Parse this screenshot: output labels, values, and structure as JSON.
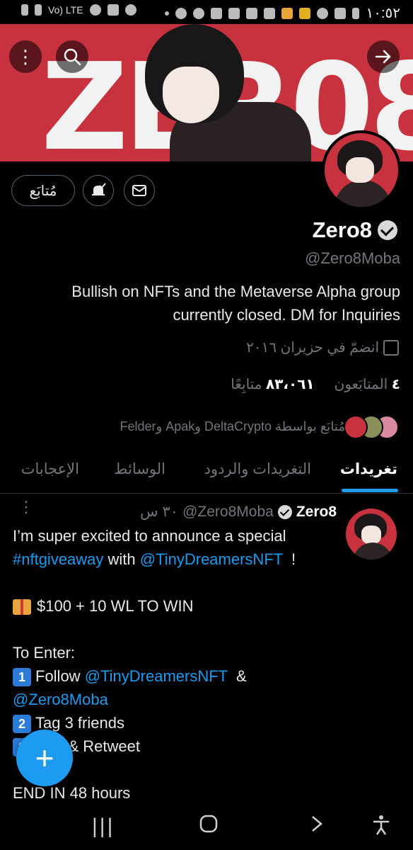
{
  "status_bar": {
    "lte_label": "Vo) LTE",
    "clock": "١٠:٥٢"
  },
  "banner": {
    "text": "ZER08"
  },
  "profile_actions": {
    "follow_label": "مُتابَع"
  },
  "profile": {
    "name": "Zero8",
    "handle": "@Zero8Moba",
    "bio_line1": "Bullish on NFTs and the Metaverse   Alpha group",
    "bio_line2": "currently closed. DM for Inquiries",
    "joined": "انضمّ في حزيران ٢٠١٦",
    "following_count": "٤",
    "following_label": "المتابَعون",
    "followers_count": "٨٣،٠٦١",
    "followers_label": "متابِعًا",
    "followed_by": "مُتابَع بواسطة DeltaCrypto وApak وFelder"
  },
  "tabs": [
    {
      "label": "تغريدات"
    },
    {
      "label": "التغريدات والردود"
    },
    {
      "label": "الوسائط"
    },
    {
      "label": "الإعجابات"
    }
  ],
  "tweet": {
    "name": "Zero8",
    "handle": "@Zero8Moba",
    "time": "٣٠ س",
    "line1": "I’m super excited to announce a special",
    "hashtag": "#nftgiveaway",
    "with_word": " with ",
    "mention1": "@TinyDreamersNFT",
    "exclaim": "  !",
    "prize": "$100 + 10 WL TO WIN",
    "to_enter": "To Enter:",
    "step1_num": "1",
    "step1_text": "Follow ",
    "step1_mention": "@TinyDreamersNFT",
    "step1_amp": "  &",
    "step1_mention2": "@Zero8Moba",
    "step2_num": "2",
    "step2_text": "Tag 3 friends",
    "step3_num": "3",
    "step3_text": "Like & Retweet",
    "end": "END IN 48 hours"
  },
  "fab": {
    "label": "+"
  },
  "colors": {
    "accent": "#1d9bf0",
    "banner_red": "#c8323f",
    "muted": "#71767b"
  }
}
